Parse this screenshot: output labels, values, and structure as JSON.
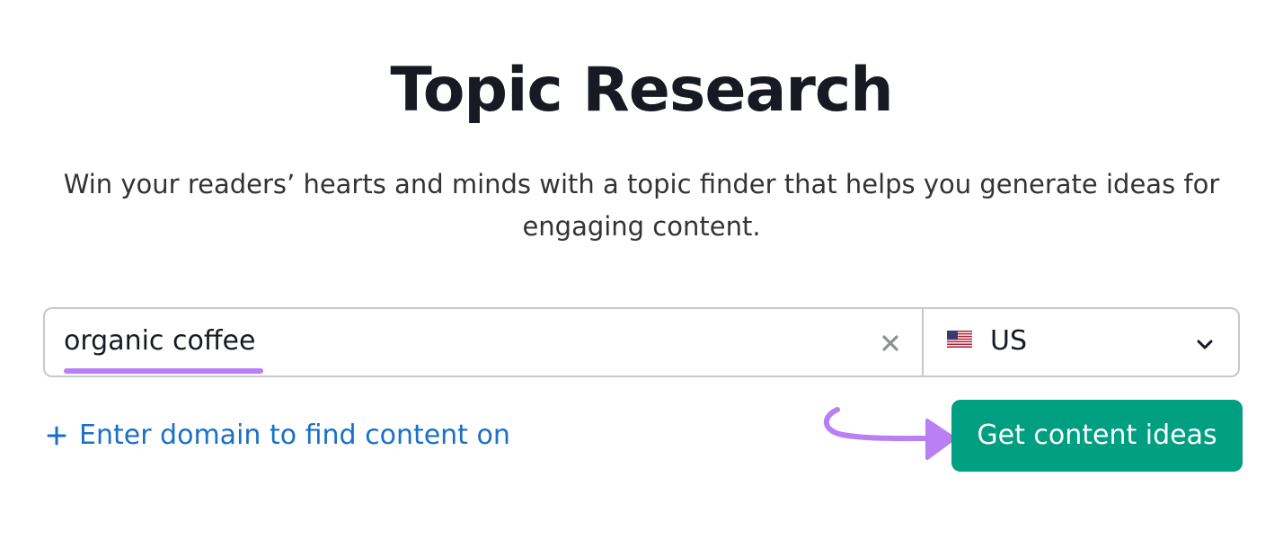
{
  "header": {
    "title": "Topic Research",
    "subtitle": "Win your readers’ hearts and minds with a topic finder that helps you generate ideas for engaging content."
  },
  "search": {
    "value": "organic coffee",
    "clear_icon": "close-icon"
  },
  "country": {
    "flag_icon": "us-flag-icon",
    "selected": "US",
    "chevron_icon": "chevron-down-icon"
  },
  "domain_link": {
    "icon": "plus-icon",
    "label": "Enter domain to find content on"
  },
  "cta": {
    "label": "Get content ideas"
  },
  "annotation": {
    "arrow_icon": "curved-arrow-icon",
    "underline_highlight": "underline-highlight"
  },
  "colors": {
    "title": "#171a22",
    "link": "#1a6fc9",
    "cta_bg": "#009f81",
    "annotation": "#b97ff5",
    "border": "#c7c8cc"
  }
}
